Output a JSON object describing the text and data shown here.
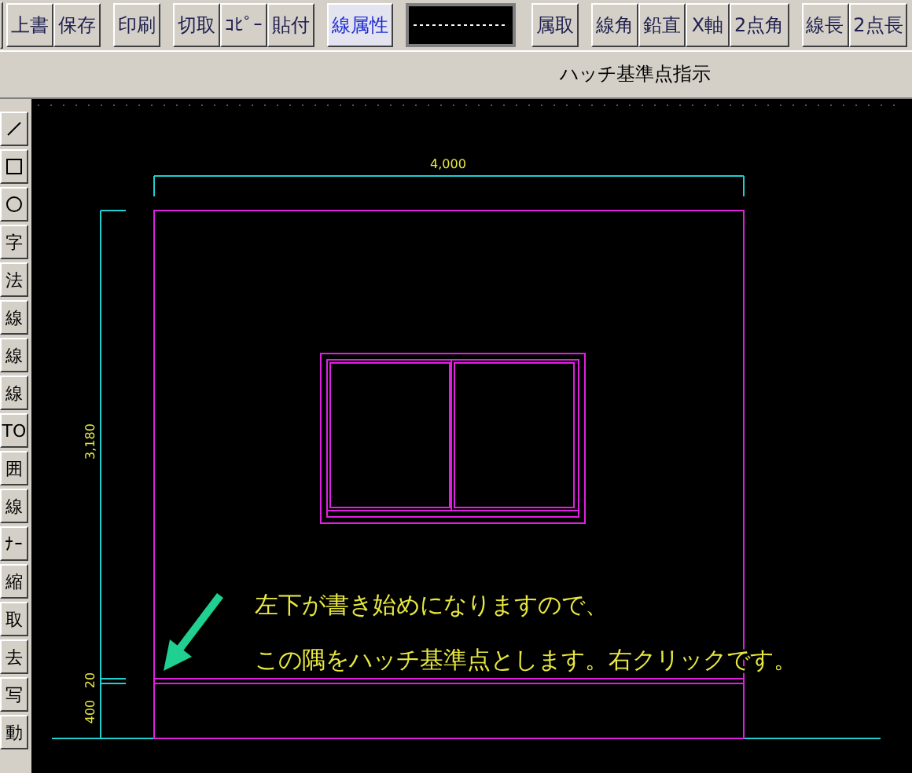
{
  "toolbar": {
    "left_groups": [
      [
        {
          "label": "上書",
          "highlighted": false
        },
        {
          "label": "保存",
          "highlighted": false
        }
      ],
      [
        {
          "label": "印刷",
          "highlighted": false
        }
      ],
      [
        {
          "label": "切取",
          "highlighted": false
        },
        {
          "label": "ｺﾋﾟｰ",
          "highlighted": false
        },
        {
          "label": "貼付",
          "highlighted": false
        }
      ],
      [
        {
          "label": "線属性",
          "highlighted": true
        }
      ]
    ],
    "right_groups": [
      [
        {
          "label": "属取",
          "highlighted": false
        }
      ],
      [
        {
          "label": "線角",
          "highlighted": false
        },
        {
          "label": "鉛直",
          "highlighted": false
        },
        {
          "label": "X軸",
          "highlighted": false
        },
        {
          "label": "2点角",
          "highlighted": false
        }
      ],
      [
        {
          "label": "線長",
          "highlighted": false
        },
        {
          "label": "2点長",
          "highlighted": false
        }
      ]
    ]
  },
  "prompt": "ハッチ基準点指示",
  "side_tools": [
    {
      "kind": "line"
    },
    {
      "kind": "rect"
    },
    {
      "kind": "circle"
    },
    {
      "kind": "text",
      "label": "字"
    },
    {
      "kind": "text",
      "label": "法"
    },
    {
      "kind": "text",
      "label": "線"
    },
    {
      "kind": "text",
      "label": "線"
    },
    {
      "kind": "text",
      "label": "線"
    },
    {
      "kind": "text",
      "label": "TO"
    },
    {
      "kind": "text",
      "label": "囲"
    },
    {
      "kind": "text",
      "label": "線"
    },
    {
      "kind": "text",
      "label": "ﾅｰ"
    },
    {
      "kind": "text",
      "label": "縮"
    },
    {
      "kind": "text",
      "label": "取"
    },
    {
      "kind": "text",
      "label": "去"
    },
    {
      "kind": "text",
      "label": "写"
    },
    {
      "kind": "text",
      "label": "動"
    }
  ],
  "drawing": {
    "width_dim": "4,000",
    "height_dim": "3,180",
    "gap_dim": "20",
    "base_dim": "400"
  },
  "note": {
    "lines": [
      "左下が書き始めになりますので、",
      "この隅をハッチ基準点とします。右クリックです。"
    ]
  }
}
